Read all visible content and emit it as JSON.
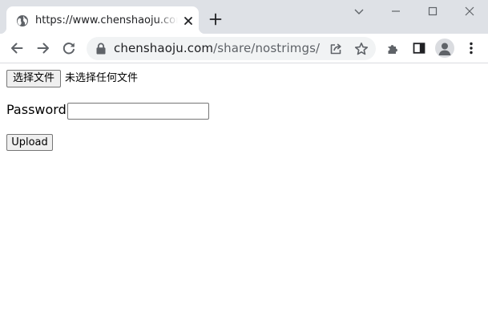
{
  "browser": {
    "tab": {
      "title": "https://www.chenshaoju.com/share/nostrimgs/",
      "favicon": "globe-icon",
      "close_icon": "close-icon"
    },
    "new_tab_icon": "plus-icon",
    "window_controls": [
      "chevron-down-icon",
      "minimize-icon",
      "maximize-icon",
      "close-icon"
    ],
    "toolbar": {
      "nav_icons": [
        "back-arrow-icon",
        "forward-arrow-icon",
        "reload-icon"
      ],
      "address": {
        "host": "chenshaoju.com",
        "path": "/share/nostrimgs/",
        "security_icon": "lock-icon"
      },
      "omnibox_icons": [
        "share-icon",
        "star-icon"
      ],
      "extension_icons": [
        "puzzle-piece-icon",
        "side-panel-icon",
        "profile-avatar-icon",
        "kebab-menu-icon"
      ]
    }
  },
  "page": {
    "file_button_label": "选择文件",
    "file_status": "未选择任何文件",
    "password_label": "Password:",
    "password_value": "",
    "upload_label": "Upload"
  },
  "colors": {
    "titlebar": "#dee1e6",
    "tab": "#ffffff",
    "omnibox": "#f1f3f4",
    "icon": "#5f6368",
    "text": "#202124"
  }
}
